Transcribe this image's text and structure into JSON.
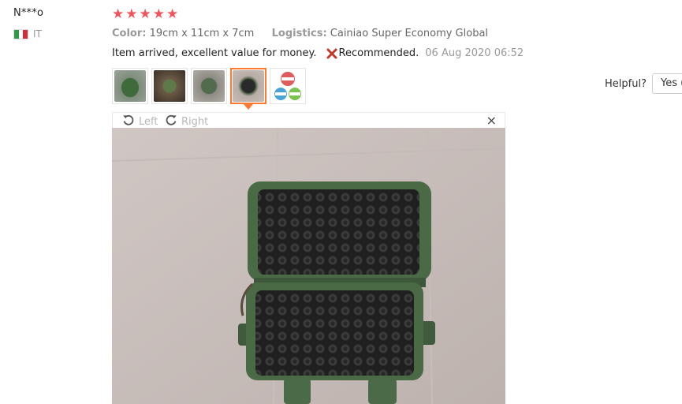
{
  "review": {
    "user_name": "N***o",
    "country": "IT",
    "rating": 5,
    "stars": [
      "★",
      "★",
      "★",
      "★",
      "★"
    ],
    "color_label": "Color:",
    "color_value": "19cm x 11cm x 7cm",
    "logistics_label": "Logistics:",
    "logistics_value": "Cainiao Super Economy Global",
    "feedback_text": "Item arrived, excellent value for money.",
    "recommended_text": "Recommended.",
    "date": "06 Aug 2020 06:52"
  },
  "thumbnails": [
    {
      "name": "thumb-1",
      "icon": "green-case-photo",
      "active": false
    },
    {
      "name": "thumb-2",
      "icon": "case-in-hand-photo",
      "active": false
    },
    {
      "name": "thumb-3",
      "icon": "case-closed-photo",
      "active": false
    },
    {
      "name": "thumb-4",
      "icon": "case-open-photo",
      "active": true
    },
    {
      "name": "thumb-5",
      "icon": "badge-stamps-photo",
      "active": false
    }
  ],
  "helpful": {
    "label": "Helpful?",
    "yes_label": "Yes ("
  },
  "viewer": {
    "left_label": "Left",
    "right_label": "Right",
    "close_symbol": "×"
  },
  "colors": {
    "star": "#f0545c",
    "active_border": "#ff7a2f",
    "case_green": "#4a6a46",
    "recommended_x": "#c0392b"
  }
}
